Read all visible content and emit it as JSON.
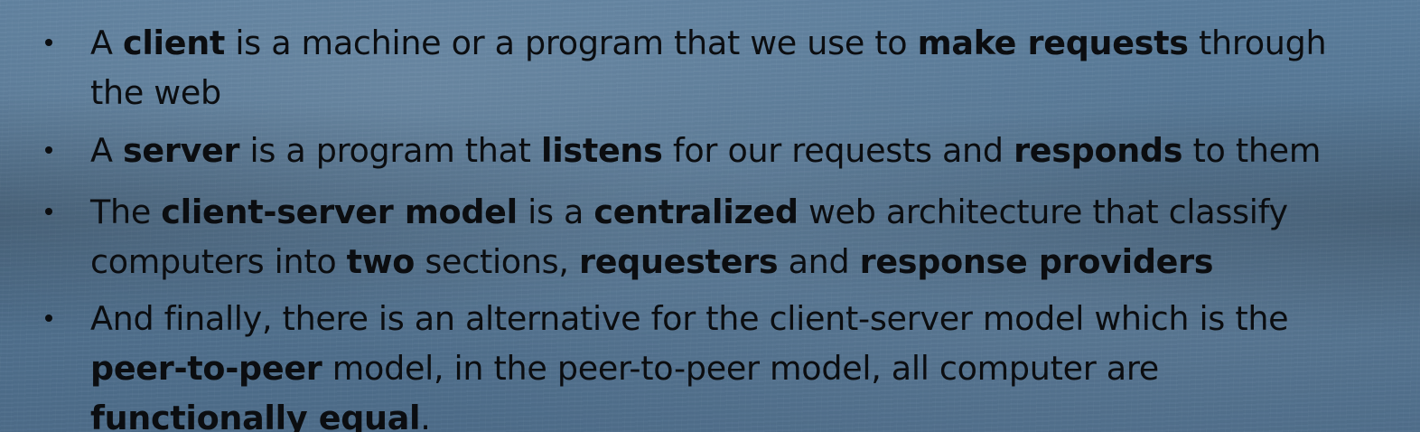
{
  "bullets": [
    {
      "lines": [
        [
          "A ",
          "client",
          " is a machine or a program that we use to ",
          "make requests",
          " through"
        ],
        [
          "the web"
        ]
      ]
    },
    {
      "lines": [
        [
          "A ",
          "server",
          " is a program that ",
          "listens",
          " for our requests and ",
          "responds",
          " to them"
        ]
      ]
    },
    {
      "lines": [
        [
          "The ",
          "client-server model",
          " is a ",
          "centralized",
          " web architecture that classify"
        ],
        [
          "computers into ",
          "two",
          " sections, ",
          "requesters",
          " and ",
          "response providers"
        ]
      ]
    },
    {
      "lines": [
        [
          "And finally, there is an alternative for the client-server model which is the"
        ],
        [
          "",
          "peer-to-peer",
          " model, in the peer-to-peer model, all computer are"
        ],
        [
          "",
          "functionally equal",
          "."
        ]
      ]
    }
  ]
}
